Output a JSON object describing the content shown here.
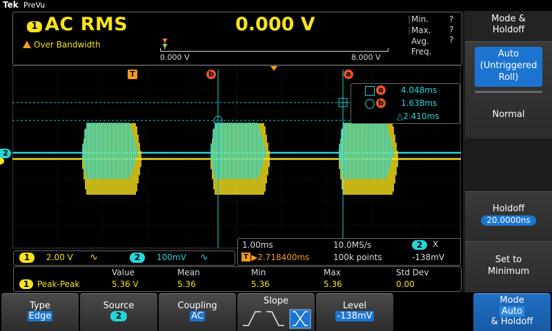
{
  "header": {
    "brand": "Tek",
    "product": "PreVu"
  },
  "dvm": {
    "channel": "1",
    "mode": "AC RMS",
    "value": "0.000 V",
    "warning": "Over Bandwidth",
    "bar_min": "0.000 V",
    "bar_max": "8.000 V",
    "stats": [
      {
        "label": "Min.",
        "value": "?"
      },
      {
        "label": "Max.",
        "value": "?"
      },
      {
        "label": "Avg.",
        "value": "?"
      },
      {
        "label": "Freq.",
        "value": ""
      }
    ]
  },
  "graticule": {
    "trigger_marker": "T",
    "cursor_b_label": "b",
    "cursor_a_label": "a",
    "ch2_marker": "2",
    "ch1_marker": "1"
  },
  "cursors": {
    "a_time": "4.048ms",
    "b_time": "1.638ms",
    "delta": "△2.410ms",
    "a_label": "a",
    "b_label": "b"
  },
  "channel_readout": {
    "ch1_label": "1",
    "ch1_scale": "2.00 V",
    "ch1_coupling": "∿",
    "ch2_label": "2",
    "ch2_scale": "100mV",
    "ch2_coupling": "∿"
  },
  "time_readout": {
    "timebase": "1.00ms",
    "sample_rate": "10.0MS/s",
    "trig_source_label": "2",
    "trig_slope": "X",
    "position_icon": "T",
    "position": "▶2.718400ms",
    "record_length": "100k points",
    "trigger_level": "-138mV"
  },
  "measurement": {
    "headers": [
      "Value",
      "Mean",
      "Min",
      "Max",
      "Std Dev"
    ],
    "rows": [
      {
        "channel": "1",
        "name": "Peak-Peak",
        "value": "5.36 V",
        "mean": "5.36",
        "min": "5.36",
        "max": "5.36",
        "std": "0.00"
      }
    ]
  },
  "side_menu": {
    "title": "Mode &\nHoldoff",
    "auto_label": "Auto\n(Untriggered\nRoll)",
    "normal_label": "Normal",
    "holdoff_label": "Holdoff",
    "holdoff_value": "20.0000ns",
    "set_min_label": "Set to\nMinimum"
  },
  "bottom_menu": {
    "type_label": "Type",
    "type_value": "Edge",
    "source_label": "Source",
    "source_value": "2",
    "coupling_label": "Coupling",
    "coupling_value": "AC",
    "slope_label": "Slope",
    "level_label": "Level",
    "level_value": "-138mV",
    "mode_label": "Mode",
    "mode_value": "Auto",
    "mode_sub": "& Holdoff"
  },
  "colors": {
    "ch1": "#f7e21b",
    "ch2": "#25d6d8",
    "accent": "#1b75d0",
    "cursor": "#e8542a"
  }
}
